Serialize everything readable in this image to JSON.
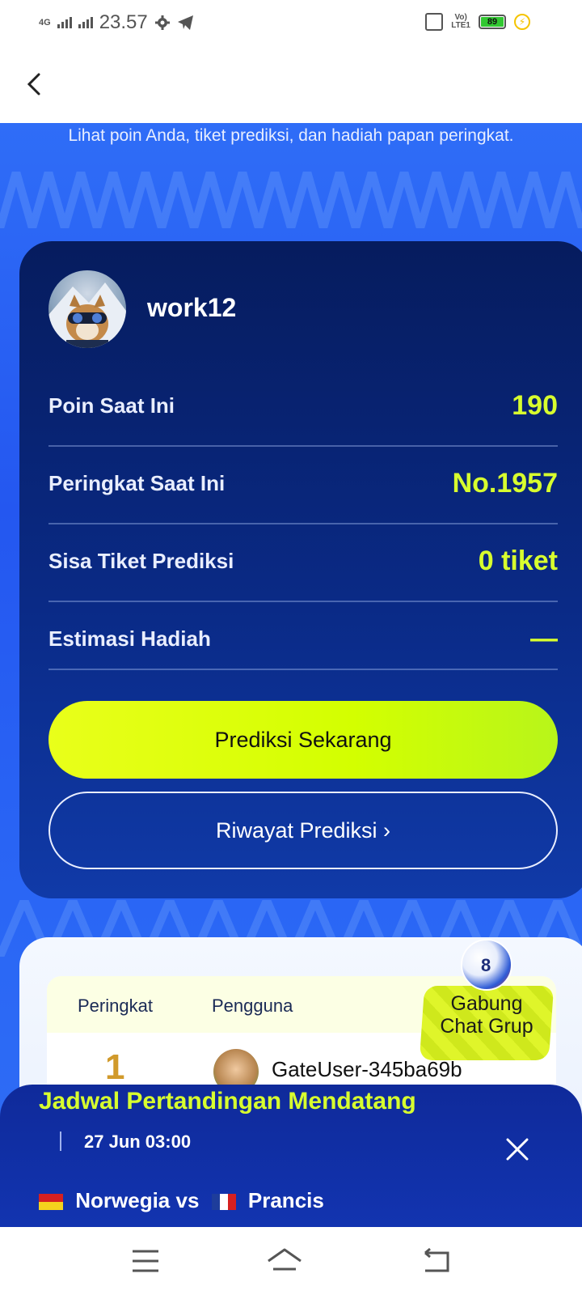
{
  "status_bar": {
    "network": "4G",
    "time": "23.57",
    "volte": "VoLTE1",
    "battery": "89"
  },
  "header": {
    "back_label": "back"
  },
  "hero": {
    "subtitle": "Lihat poin Anda, tiket prediksi, dan hadiah papan peringkat."
  },
  "profile": {
    "username": "work12"
  },
  "stats": [
    {
      "label": "Poin Saat Ini",
      "value": "190"
    },
    {
      "label": "Peringkat Saat Ini",
      "value": "No.1957"
    },
    {
      "label": "Sisa Tiket Prediksi",
      "value": "0 tiket"
    },
    {
      "label": "Estimasi Hadiah",
      "value": "—"
    }
  ],
  "actions": {
    "predict_now": "Prediksi Sekarang",
    "history": "Riwayat Prediksi ›"
  },
  "leaderboard": {
    "col_rank": "Peringkat",
    "col_user": "Pengguna",
    "rows": [
      {
        "rank": "1",
        "name": "GateUser-345ba69b"
      }
    ]
  },
  "chat_float": {
    "line1": "Gabung",
    "line2": "Chat Grup"
  },
  "schedule": {
    "title": "Jadwal Pertandingan Mendatang",
    "time": "27 Jun 03:00",
    "team_a": "Norwegia",
    "vs": "vs",
    "team_b": "Prancis"
  },
  "colors": {
    "accent": "#d8ff2e",
    "card_bg": "#0a2a86",
    "hero_bg": "#2457f0"
  },
  "icons": [
    "back-icon",
    "settings-icon",
    "telegram-icon",
    "vibrate-icon",
    "battery-icon",
    "charging-icon",
    "close-icon",
    "menu-icon",
    "home-icon",
    "return-icon"
  ]
}
